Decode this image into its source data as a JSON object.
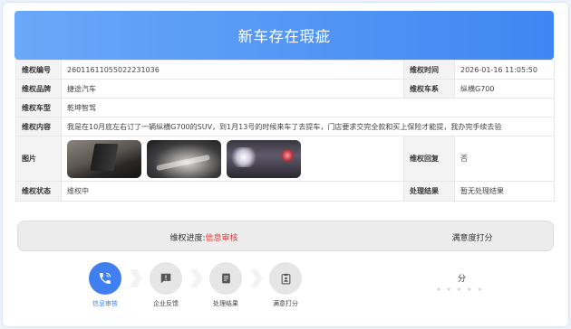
{
  "banner": {
    "title": "新车存在瑕疵"
  },
  "info": {
    "complaint_no_label": "维权编号",
    "complaint_no": "26011611055022231036",
    "complaint_time_label": "维权时间",
    "complaint_time": "2026-01-16 11:05:50",
    "brand_label": "维权品牌",
    "brand": "捷途汽车",
    "series_label": "维权车系",
    "series": "纵横G700",
    "model_label": "维权车型",
    "model": "乾坤智驾",
    "content_label": "维权内容",
    "content": "我是在10月底左右订了一辆纵横G700的SUV，到1月13号的时候来车了去提车，门店要求交完全款和买上保险才能提，我办完手续去验",
    "images_label": "图片",
    "reply_label": "维权回复",
    "reply": "否",
    "status_label": "维权状态",
    "status": "维权中",
    "result_label": "处理结果",
    "result": "暂无处理结果"
  },
  "progress": {
    "prefix": "维权进度:",
    "current": "信息审核",
    "satisfaction_label": "满意度打分",
    "highlight_color": "#e53935",
    "accent_color": "#3f7ff0",
    "steps": [
      {
        "label": "信息审核",
        "icon": "phone-icon",
        "active": true
      },
      {
        "label": "企业反馈",
        "icon": "message-icon",
        "active": false
      },
      {
        "label": "处理结果",
        "icon": "document-icon",
        "active": false
      },
      {
        "label": "满意打分",
        "icon": "rating-clipboard-icon",
        "active": false
      }
    ],
    "score_unit": "分",
    "star_count": 5
  }
}
